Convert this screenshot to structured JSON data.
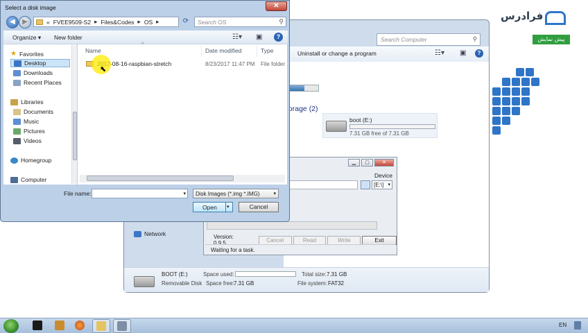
{
  "computer_window": {
    "search_placeholder": "Search Computer",
    "toolbar_item": "Uninstall or change a program",
    "storage_heading": "torage (2)",
    "drive": {
      "name": "boot (E:)",
      "free_text": "7.31 GB free of 7.31 GB"
    },
    "nav_network": "Network",
    "details": {
      "name": "BOOT (E:)",
      "kind": "Removable Disk",
      "space_used_label": "Space used:",
      "space_free_label": "Space free:",
      "space_free_value": "7.31 GB",
      "total_size_label": "Total size:",
      "total_size_value": "7.31 GB",
      "file_system_label": "File system:",
      "file_system_value": "FAT32"
    }
  },
  "imager": {
    "device_label": "Device",
    "device_value": "[E:\\]",
    "version": "Version: 0.9.5",
    "buttons": {
      "cancel": "Cancel",
      "read": "Read",
      "write": "Write",
      "exit": "Exit"
    },
    "status": "Waiting for a task."
  },
  "dialog": {
    "title": "Select a disk image",
    "breadcrumb": [
      "«",
      "FVEE9509-S2",
      "▸",
      "Files&Codes",
      "▸",
      "OS",
      "▸"
    ],
    "search_placeholder": "Search OS",
    "toolbar": {
      "organize": "Organize ▾",
      "new_folder": "New folder"
    },
    "nav": {
      "favorites": "Favorites",
      "desktop": "Desktop",
      "downloads": "Downloads",
      "recent": "Recent Places",
      "libraries": "Libraries",
      "documents": "Documents",
      "music": "Music",
      "pictures": "Pictures",
      "videos": "Videos",
      "homegroup": "Homegroup",
      "computer": "Computer"
    },
    "columns": {
      "name": "Name",
      "date": "Date modified",
      "type": "Type"
    },
    "files": [
      {
        "name": "2017-08-16-raspbian-stretch",
        "date": "8/23/2017 11:47 PM",
        "type": "File folder"
      }
    ],
    "file_name_label": "File name:",
    "file_name_value": "",
    "filter": "Disk Images (*.img *.IMG)",
    "open": "Open",
    "cancel": "Cancel"
  },
  "taskbar": {
    "language": "EN"
  },
  "watermark": {
    "brand": "فرادرس",
    "badge": "پیش نمایش"
  }
}
